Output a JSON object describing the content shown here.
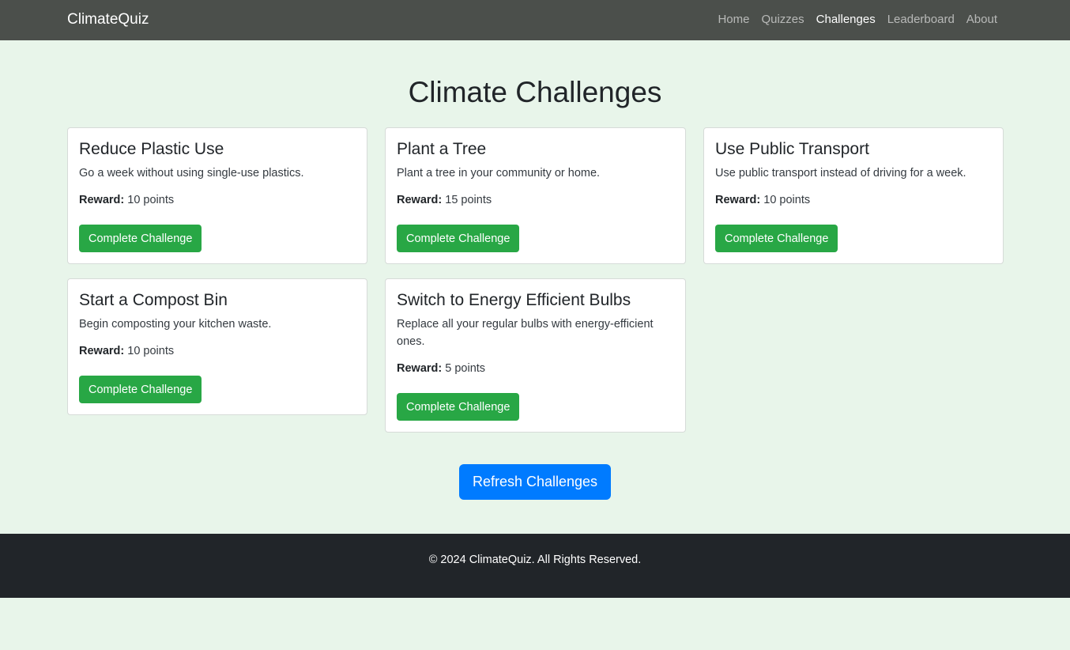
{
  "navbar": {
    "brand": "ClimateQuiz",
    "links": [
      {
        "label": "Home",
        "active": false
      },
      {
        "label": "Quizzes",
        "active": false
      },
      {
        "label": "Challenges",
        "active": true
      },
      {
        "label": "Leaderboard",
        "active": false
      },
      {
        "label": "About",
        "active": false
      }
    ]
  },
  "main": {
    "title": "Climate Challenges",
    "reward_label": "Reward:",
    "challenges": [
      {
        "title": "Reduce Plastic Use",
        "description": "Go a week without using single-use plastics.",
        "reward": "10 points",
        "button": "Complete Challenge"
      },
      {
        "title": "Plant a Tree",
        "description": "Plant a tree in your community or home.",
        "reward": "15 points",
        "button": "Complete Challenge"
      },
      {
        "title": "Use Public Transport",
        "description": "Use public transport instead of driving for a week.",
        "reward": "10 points",
        "button": "Complete Challenge"
      },
      {
        "title": "Start a Compost Bin",
        "description": "Begin composting your kitchen waste.",
        "reward": "10 points",
        "button": "Complete Challenge"
      },
      {
        "title": "Switch to Energy Efficient Bulbs",
        "description": "Replace all your regular bulbs with energy-efficient ones.",
        "reward": "5 points",
        "button": "Complete Challenge"
      }
    ],
    "refresh_button": "Refresh Challenges"
  },
  "footer": {
    "text": "© 2024 ClimateQuiz. All Rights Reserved."
  },
  "colors": {
    "navbar_bg": "#4b4f4b",
    "page_bg": "#e8f5ea",
    "success": "#28a745",
    "primary": "#007bff",
    "footer_bg": "#212529"
  }
}
